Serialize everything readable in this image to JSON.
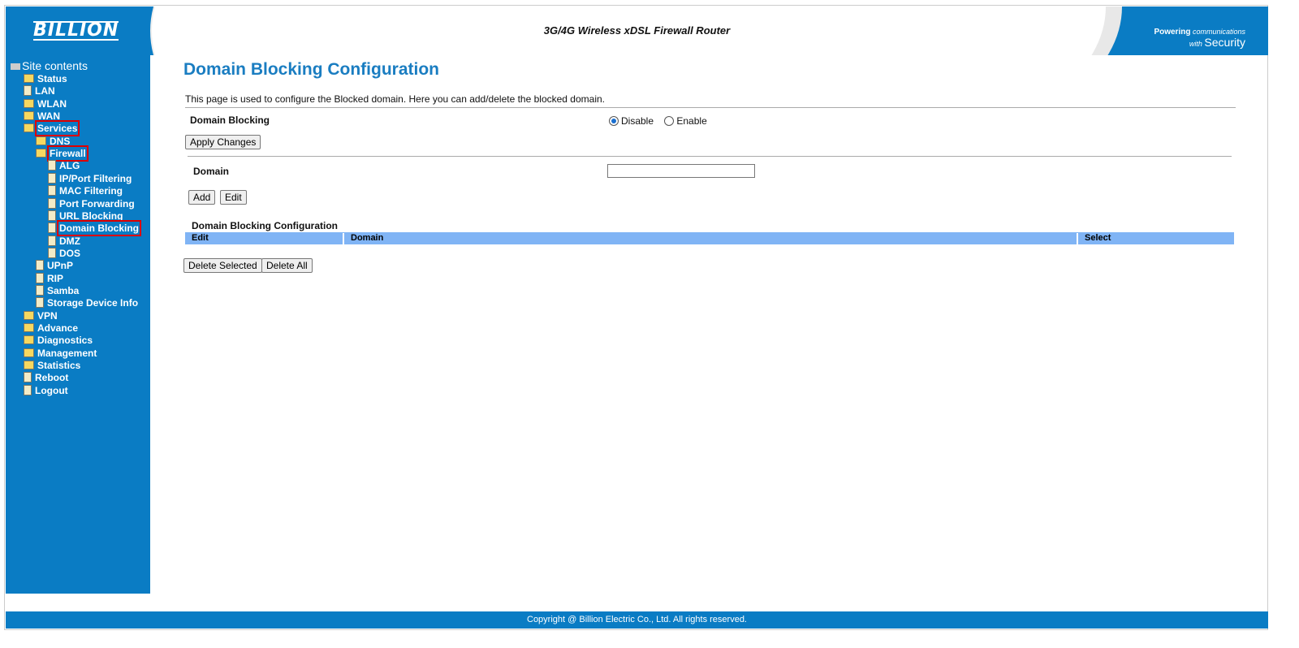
{
  "header": {
    "logo": "BILLION",
    "title": "3G/4G Wireless xDSL Firewall Router",
    "slogan_1": "Powering",
    "slogan_2": "communications",
    "slogan_3": "with",
    "slogan_4": "Security"
  },
  "sidebar": {
    "root": "Site contents",
    "items": [
      {
        "label": "Status",
        "type": "folder",
        "level": 0
      },
      {
        "label": "LAN",
        "type": "doc",
        "level": 0
      },
      {
        "label": "WLAN",
        "type": "folder",
        "level": 0
      },
      {
        "label": "WAN",
        "type": "folder",
        "level": 0
      },
      {
        "label": "Services",
        "type": "folder",
        "level": 0,
        "highlight": true
      },
      {
        "label": "DNS",
        "type": "folder",
        "level": 1
      },
      {
        "label": "Firewall",
        "type": "folder",
        "level": 1,
        "highlight": true
      },
      {
        "label": "ALG",
        "type": "doc",
        "level": 2
      },
      {
        "label": "IP/Port Filtering",
        "type": "doc",
        "level": 2
      },
      {
        "label": "MAC Filtering",
        "type": "doc",
        "level": 2
      },
      {
        "label": "Port Forwarding",
        "type": "doc",
        "level": 2
      },
      {
        "label": "URL Blocking",
        "type": "doc",
        "level": 2
      },
      {
        "label": "Domain Blocking",
        "type": "doc",
        "level": 2,
        "highlight": true
      },
      {
        "label": "DMZ",
        "type": "doc",
        "level": 2
      },
      {
        "label": "DOS",
        "type": "doc",
        "level": 2
      },
      {
        "label": "UPnP",
        "type": "doc",
        "level": 1
      },
      {
        "label": "RIP",
        "type": "doc",
        "level": 1
      },
      {
        "label": "Samba",
        "type": "doc",
        "level": 1
      },
      {
        "label": "Storage Device Info",
        "type": "doc",
        "level": 1
      },
      {
        "label": "VPN",
        "type": "folder",
        "level": 0
      },
      {
        "label": "Advance",
        "type": "folder",
        "level": 0
      },
      {
        "label": "Diagnostics",
        "type": "folder",
        "level": 0
      },
      {
        "label": "Management",
        "type": "folder",
        "level": 0
      },
      {
        "label": "Statistics",
        "type": "folder",
        "level": 0
      },
      {
        "label": "Reboot",
        "type": "doc",
        "level": 0
      },
      {
        "label": "Logout",
        "type": "doc",
        "level": 0
      }
    ]
  },
  "main": {
    "title": "Domain Blocking Configuration",
    "description": "This page is used to configure the Blocked domain. Here you can add/delete the blocked domain.",
    "blocking_label": "Domain Blocking",
    "disable_label": "Disable",
    "enable_label": "Enable",
    "selected": "Disable",
    "apply_label": "Apply Changes",
    "domain_label": "Domain",
    "domain_value": "",
    "add_label": "Add",
    "edit_label": "Edit",
    "table_title": "Domain Blocking Configuration",
    "columns": [
      "Edit",
      "Domain",
      "Select"
    ],
    "delete_selected_label": "Delete Selected",
    "delete_all_label": "Delete All"
  },
  "footer": {
    "copyright": "Copyright @ Billion Electric Co., Ltd. All rights reserved."
  }
}
